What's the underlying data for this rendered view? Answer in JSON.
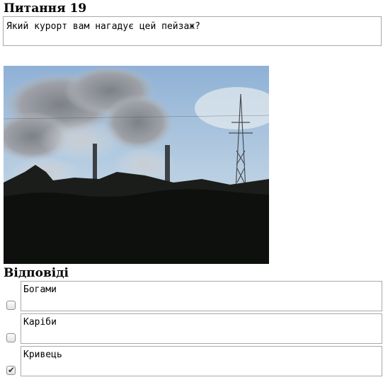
{
  "question": {
    "heading": "Питання 19",
    "text": "Який курорт вам нагадує цей пейзаж?"
  },
  "answers_heading": "Відповіді",
  "answers": [
    {
      "label": "Богами",
      "checked": false
    },
    {
      "label": "Каріби",
      "checked": false
    },
    {
      "label": "Кривець",
      "checked": true
    }
  ],
  "icons": {
    "checkbox_tick": "✔"
  }
}
